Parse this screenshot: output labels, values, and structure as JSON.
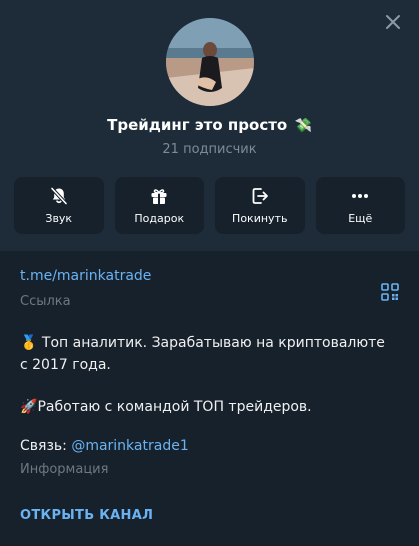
{
  "window": {
    "close_icon": "close-icon"
  },
  "channel": {
    "title": "Трейдинг это просто",
    "title_emoji": "💸",
    "subscribers": "21 подписчик"
  },
  "actions": [
    {
      "label": "Звук",
      "icon": "bell-off-icon"
    },
    {
      "label": "Подарок",
      "icon": "gift-icon"
    },
    {
      "label": "Покинуть",
      "icon": "leave-icon"
    },
    {
      "label": "Ещё",
      "icon": "more-icon"
    }
  ],
  "link": {
    "url": "t.me/marinkatrade",
    "hint": "Ссылка",
    "qr_icon": "qr-code-icon"
  },
  "bio": {
    "line1_emoji": "🥇",
    "line1": " Топ аналитик. Зарабатываю на криптовалюте с 2017 года.",
    "line2_emoji": "🚀",
    "line2": "Работаю с командой ТОП трейдеров.",
    "contact_prefix": "Связь: ",
    "contact_handle": "@marinkatrade1",
    "hint": "Информация"
  },
  "open_channel": "ОТКРЫТЬ КАНАЛ",
  "colors": {
    "background": "#17212b",
    "header": "#1e2c3a",
    "accent": "#6ab3f3",
    "muted": "#6d7883"
  }
}
